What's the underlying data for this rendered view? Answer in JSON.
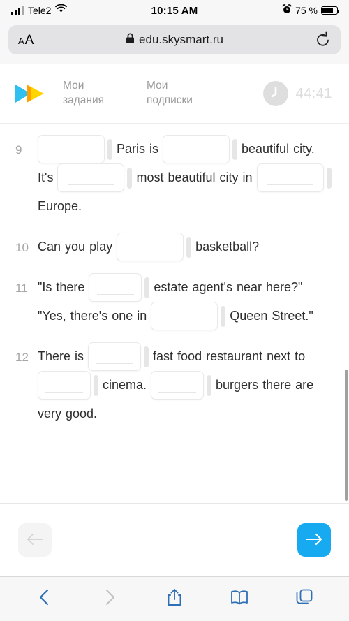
{
  "status_bar": {
    "carrier": "Tele2",
    "time": "10:15 AM",
    "battery_percent": "75 %",
    "signal_icon": "cellular-signal-icon",
    "wifi_icon": "wifi-icon",
    "alarm_icon": "alarm-clock-icon",
    "battery_icon": "battery-icon"
  },
  "browser": {
    "text_size_label_small": "A",
    "text_size_label_large": "A",
    "lock_icon": "lock-icon",
    "url": "edu.skysmart.ru",
    "reload_icon": "reload-icon",
    "toolbar": {
      "back_icon": "chevron-left-icon",
      "forward_icon": "chevron-right-icon",
      "share_icon": "share-icon",
      "bookmarks_icon": "book-icon",
      "tabs_icon": "tabs-icon"
    }
  },
  "app_header": {
    "logo_icon": "skysmart-logo-icon",
    "nav": [
      {
        "line1": "Мои",
        "line2": "задания"
      },
      {
        "line1": "Мои",
        "line2": "подписки"
      }
    ],
    "timer_icon": "clock-icon",
    "timer_value": "44:41"
  },
  "exercise": {
    "questions": [
      {
        "number": "9",
        "tokens": [
          {
            "type": "blank",
            "width": "wide"
          },
          {
            "type": "text",
            "value": "Paris is"
          },
          {
            "type": "blank",
            "width": "wide"
          },
          {
            "type": "text",
            "value": "beautiful city. It's"
          },
          {
            "type": "blank",
            "width": "wide"
          },
          {
            "type": "text",
            "value": "most beautiful city in"
          },
          {
            "type": "blank",
            "width": "wide"
          },
          {
            "type": "text",
            "value": "Europe."
          }
        ]
      },
      {
        "number": "10",
        "tokens": [
          {
            "type": "text",
            "value": "Can you play"
          },
          {
            "type": "blank",
            "width": "wide"
          },
          {
            "type": "text",
            "value": "basketball?"
          }
        ]
      },
      {
        "number": "11",
        "tokens": [
          {
            "type": "text",
            "value": "\"Is there"
          },
          {
            "type": "blank",
            "width": "normal"
          },
          {
            "type": "text",
            "value": "estate agent's near here?\" \"Yes, there's one in"
          },
          {
            "type": "blank",
            "width": "wide"
          },
          {
            "type": "text",
            "value": "Queen Street.\""
          }
        ]
      },
      {
        "number": "12",
        "tokens": [
          {
            "type": "text",
            "value": "There is"
          },
          {
            "type": "blank",
            "width": "normal"
          },
          {
            "type": "text",
            "value": "fast food restaurant next to"
          },
          {
            "type": "blank",
            "width": "normal"
          },
          {
            "type": "text",
            "value": "cinema."
          },
          {
            "type": "blank",
            "width": "normal"
          },
          {
            "type": "text",
            "value": "burgers there are very good."
          }
        ]
      }
    ]
  },
  "footer": {
    "prev_icon": "arrow-left-icon",
    "next_icon": "arrow-right-icon"
  },
  "colors": {
    "accent_blue": "#18aaf0",
    "logo_blue": "#2fc0ef",
    "logo_yellow": "#ffd400",
    "logo_orange": "#ff9d00"
  }
}
